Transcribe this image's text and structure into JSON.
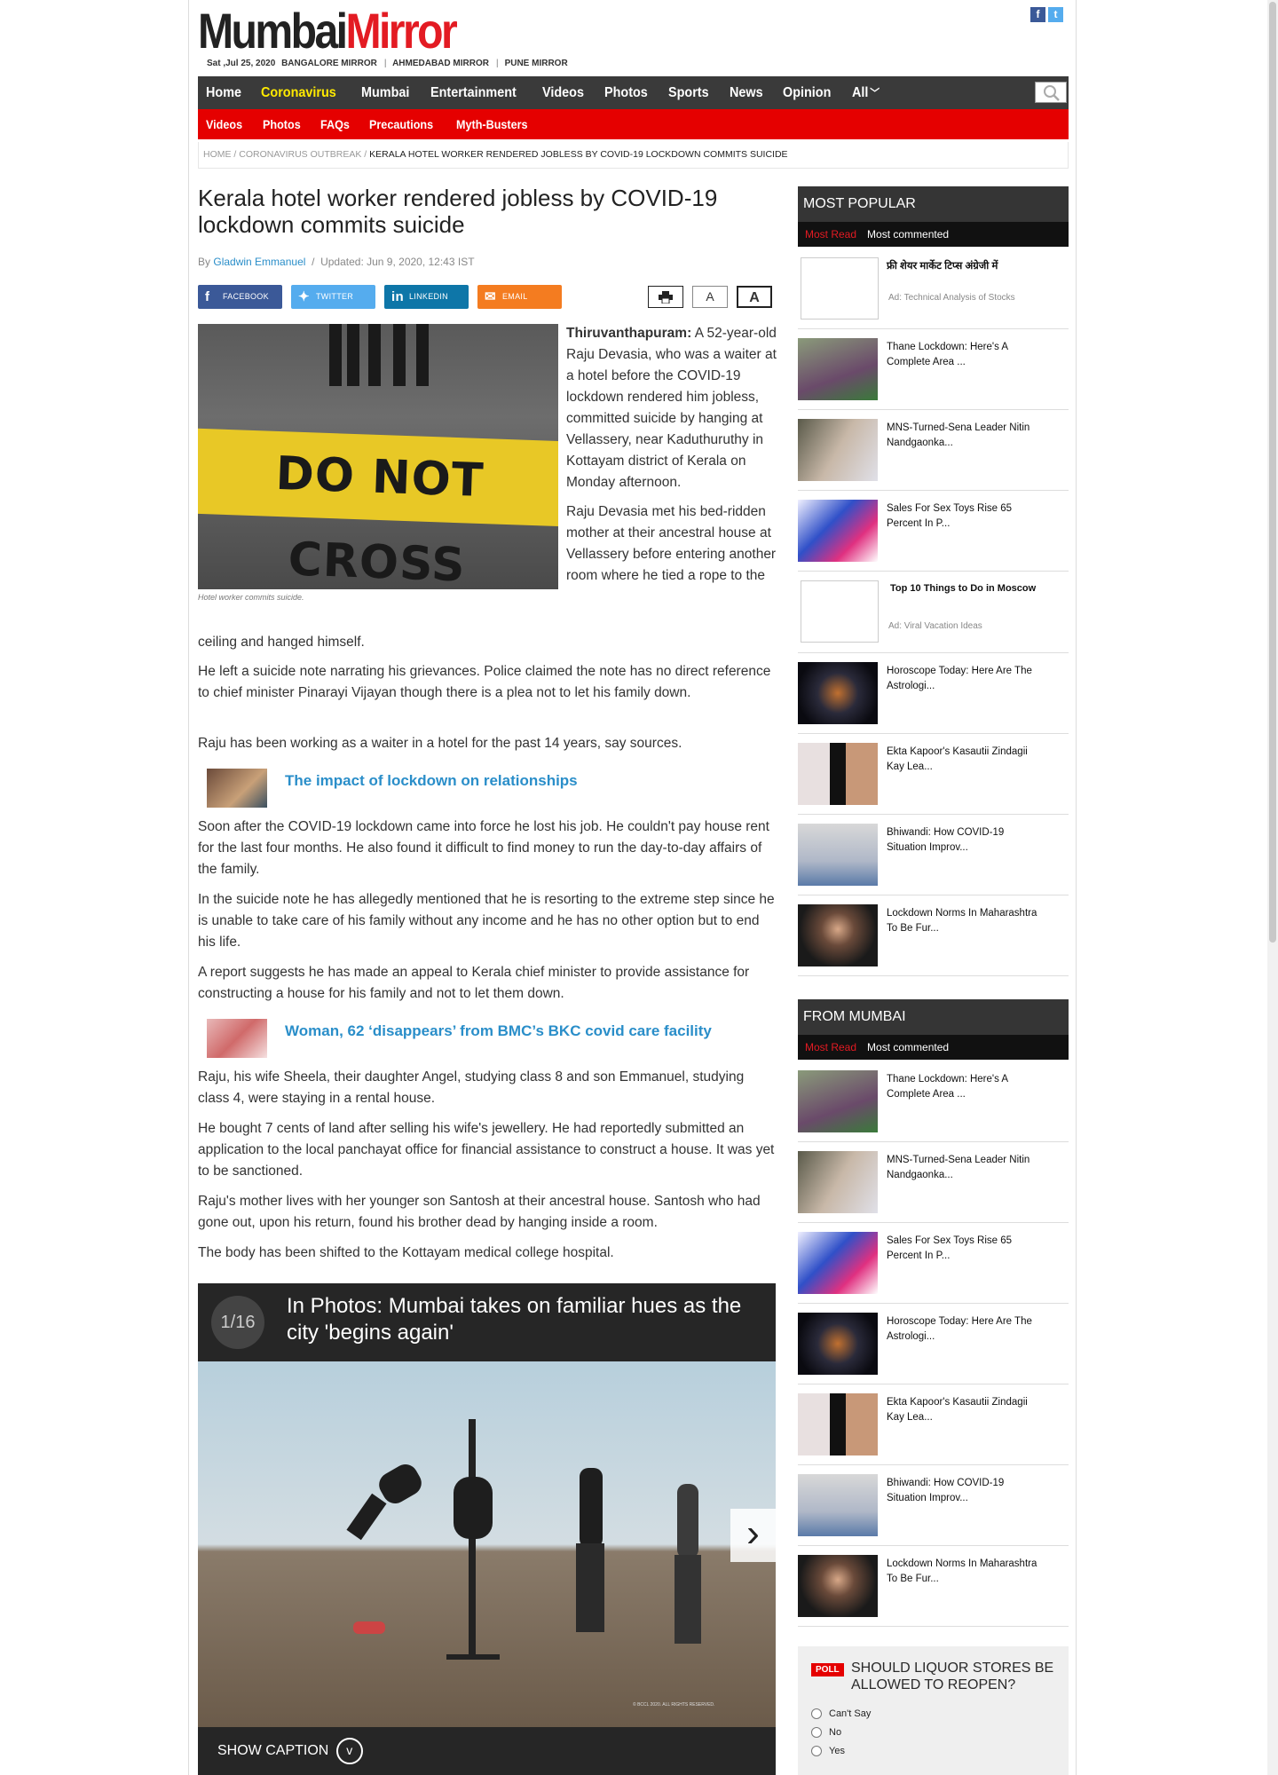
{
  "header": {
    "logo_part1": "Mumbai",
    "logo_part2": "Mirror",
    "date": "Sat ,Jul 25, 2020",
    "editions": [
      "BANGALORE MIRROR",
      "AHMEDABAD MIRROR",
      "PUNE MIRROR"
    ],
    "facebook": "f",
    "twitter": "t"
  },
  "nav": {
    "items": [
      "Home",
      "Coronavirus",
      "Mumbai",
      "Entertainment",
      "Videos",
      "Photos",
      "Sports",
      "News",
      "Opinion",
      "All"
    ],
    "all_chevron": "﹀"
  },
  "subnav": {
    "items": [
      "Videos",
      "Photos",
      "FAQs",
      "Precautions",
      "Myth-Busters"
    ]
  },
  "breadcrumb": {
    "home": "HOME",
    "section": "CORONAVIRUS OUTBREAK",
    "current": "KERALA HOTEL WORKER RENDERED JOBLESS BY COVID-19 LOCKDOWN COMMITS SUICIDE"
  },
  "article": {
    "title": "Kerala hotel worker rendered jobless by COVID-19 lockdown commits suicide",
    "by": "By",
    "author": "Gladwin Emmanuel",
    "updated": "Updated: Jun 9, 2020, 12:43 IST",
    "share": {
      "facebook": "FACEBOOK",
      "twitter": "TWITTER",
      "linkedin": "LINKEDIN",
      "email": "EMAIL"
    },
    "font_small": "A",
    "font_large": "A",
    "image_text": "DO NOT CROSS",
    "image_caption": "Hotel worker commits suicide.",
    "dateline": "Thiruvanthapuram:",
    "lead": "A 52-year-old Raju Devasia, who was a waiter at a hotel before the COVID-19 lockdown rendered him jobless, committed suicide by hanging at Vellassery, near Kaduthuruthy in Kottayam district of Kerala on Monday afternoon.",
    "p2_wrap": "Raju Devasia met his bed-ridden mother at their ancestral house at Vellassery before entering another room where he tied a rope to the",
    "p2_full": "ceiling and hanged himself.",
    "p3": "He left a suicide note narrating his grievances. Police claimed the note has no direct reference to chief minister Pinarayi Vijayan though there is a plea not to let his family down.",
    "p4": "Raju has been working as a waiter in a hotel for the past 14 years, say sources.",
    "related1": "The impact of lockdown on relationships",
    "p5": "Soon after the COVID-19 lockdown came into force he lost his job. He couldn't pay house rent for the last four months. He also found it difficult to find money to run the day-to-day affairs of the family.",
    "p6": "In the suicide note he has allegedly mentioned that he is resorting to the extreme step since he is unable to take care of his family without any income and he has no other option but to end his life.",
    "p7": "A report suggests he has made an appeal to Kerala chief minister to provide assistance for constructing a house for his family and not to let them down.",
    "related2": "Woman, 62 ‘disappears’ from BMC’s BKC covid care facility",
    "p8": "Raju, his wife Sheela, their daughter Angel, studying class 8 and son Emmanuel, studying class 4, were staying in a rental house.",
    "p9": "He bought 7 cents of land after selling his wife's jewellery. He had reportedly submitted an application to the local panchayat office for financial assistance to construct a house. It was yet to be sanctioned.",
    "p10": "Raju's mother lives with her younger son Santosh at their ancestral house. Santosh who had gone out, upon his return, found his brother dead by hanging inside a room.",
    "p11": "The body has been shifted to the Kottayam medical college hospital."
  },
  "gallery": {
    "counter": "1/16",
    "title": "In Photos: Mumbai takes on familiar hues as the city 'begins again'",
    "show_caption": "SHOW CAPTION",
    "chevron": "v",
    "next": "›",
    "watermark": "© BCCL 2020. ALL RIGHTS RESERVED."
  },
  "most_popular": {
    "heading": "MOST POPULAR",
    "tab_active": "Most Read",
    "tab_other": "Most commented",
    "items": [
      {
        "text": "फ्री शेयर मार्केट टिप्स अंग्रेजी में",
        "sponsor": "Ad: Technical Analysis of Stocks"
      },
      {
        "text": "Thane Lockdown: Here's A Complete Area ..."
      },
      {
        "text": "MNS-Turned-Sena Leader Nitin Nandgaonka..."
      },
      {
        "text": "Sales For Sex Toys Rise 65 Percent In P..."
      },
      {
        "text": "Top 10 Things to Do in Moscow",
        "sponsor": "Ad: Viral Vacation Ideas"
      },
      {
        "text": "Horoscope Today: Here Are The Astrologi..."
      },
      {
        "text": "Ekta Kapoor's Kasautii Zindagii Kay Lea..."
      },
      {
        "text": "Bhiwandi: How COVID-19 Situation Improv..."
      },
      {
        "text": "Lockdown Norms In Maharashtra To Be Fur..."
      }
    ]
  },
  "from_mumbai": {
    "heading": "FROM MUMBAI",
    "tab_active": "Most Read",
    "tab_other": "Most commented",
    "items": [
      {
        "text": "Thane Lockdown: Here's A Complete Area ..."
      },
      {
        "text": "MNS-Turned-Sena Leader Nitin Nandgaonka..."
      },
      {
        "text": "Sales For Sex Toys Rise 65 Percent In P..."
      },
      {
        "text": "Horoscope Today: Here Are The Astrologi..."
      },
      {
        "text": "Ekta Kapoor's Kasautii Zindagii Kay Lea..."
      },
      {
        "text": "Bhiwandi: How COVID-19 Situation Improv..."
      },
      {
        "text": "Lockdown Norms In Maharashtra To Be Fur..."
      }
    ]
  },
  "poll": {
    "badge": "POLL",
    "question": "SHOULD LIQUOR STORES BE ALLOWED TO REOPEN?",
    "options": [
      "Can't Say",
      "No",
      "Yes"
    ]
  },
  "colors": {
    "brand_red": "#e31b23",
    "nav_dark": "#3a3a3a",
    "subnav_red": "#e50000",
    "link_blue": "#2a8ec9",
    "highlight_yellow": "#ffea00"
  }
}
